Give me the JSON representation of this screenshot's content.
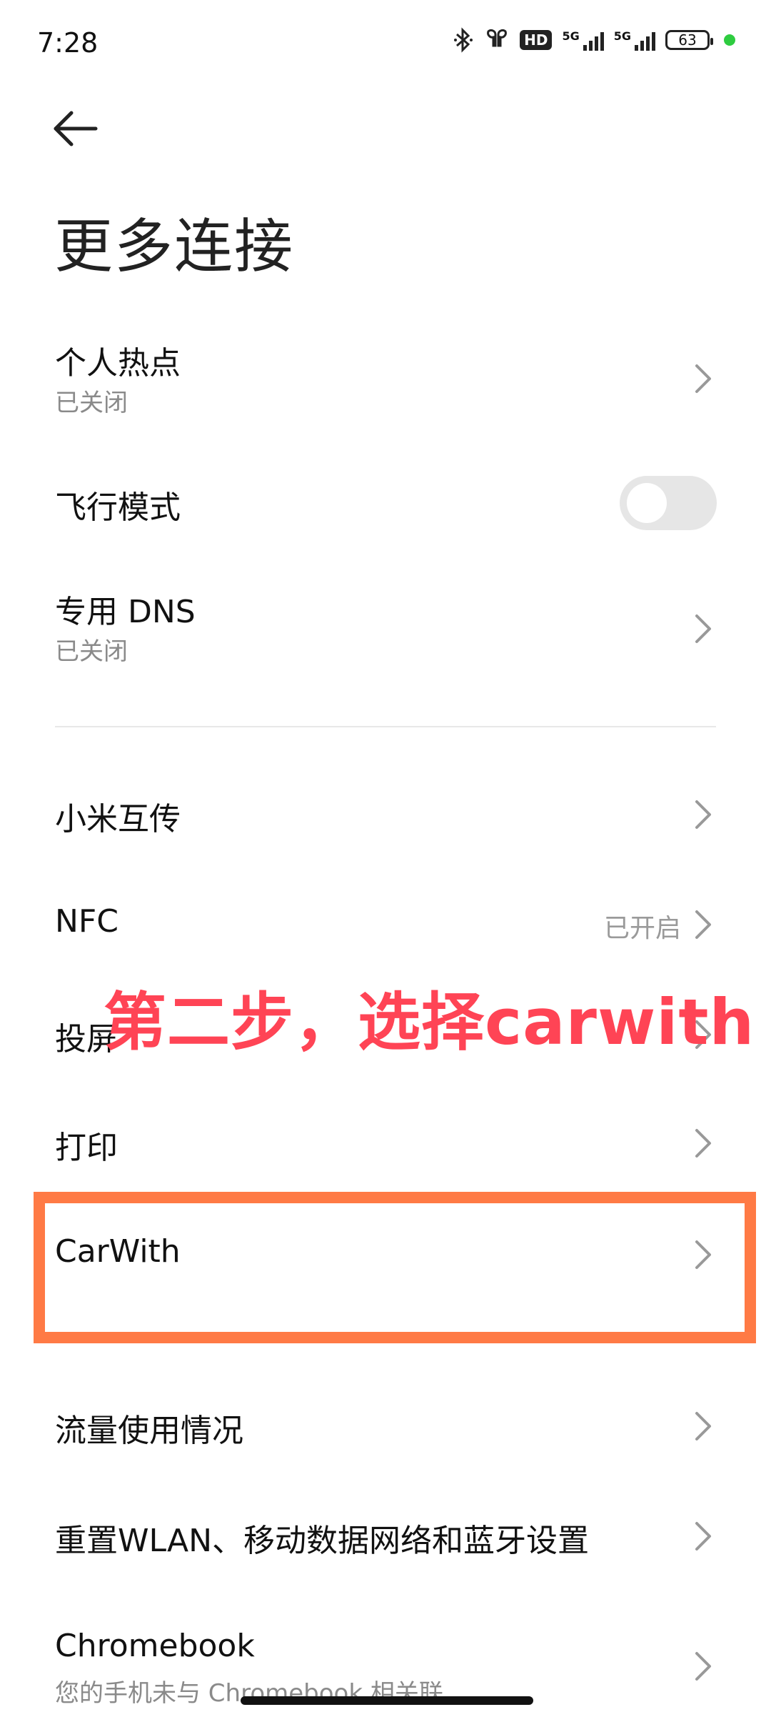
{
  "status_bar": {
    "time": "7:28",
    "hd_label": "HD",
    "sim1_tag": "5G",
    "sim2_tag": "5G",
    "battery": "63",
    "dot_color": "#2ecc40"
  },
  "header": {
    "title": "更多连接"
  },
  "rows": {
    "hotspot": {
      "title": "个人热点",
      "subtitle": "已关闭"
    },
    "airplane": {
      "title": "飞行模式",
      "toggle_on": false
    },
    "dns": {
      "title": "专用 DNS",
      "subtitle": "已关闭"
    },
    "mi_share": {
      "title": "小米互传"
    },
    "nfc": {
      "title": "NFC",
      "value": "已开启"
    },
    "cast": {
      "title": "投屏"
    },
    "print": {
      "title": "打印"
    },
    "carwith": {
      "title": "CarWith"
    },
    "data_usage": {
      "title": "流量使用情况"
    },
    "reset": {
      "title": "重置WLAN、移动数据网络和蓝牙设置"
    },
    "chromebook": {
      "title": "Chromebook",
      "subtitle": "您的手机未与 Chromebook 相关联"
    }
  },
  "annotation": {
    "text": "第二步，选择carwith",
    "color": "#ff4455",
    "box_color": "#ff7a45"
  }
}
